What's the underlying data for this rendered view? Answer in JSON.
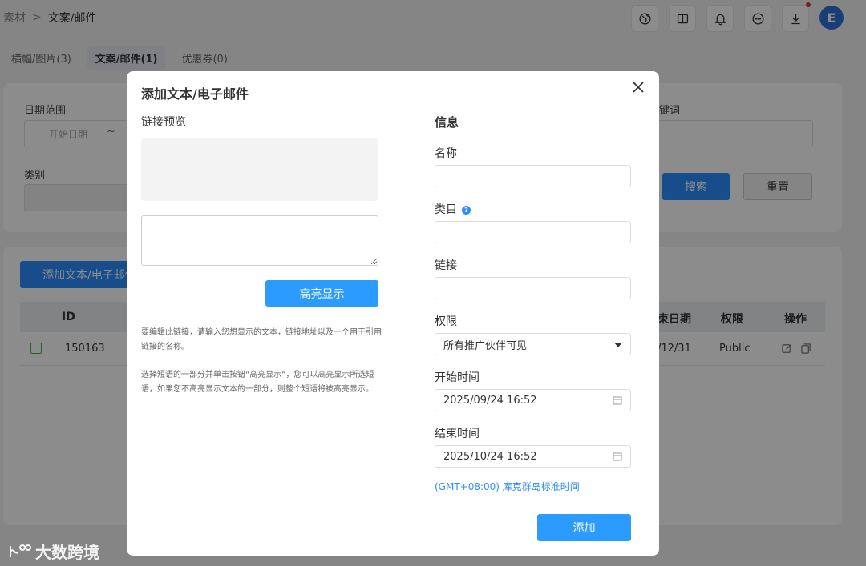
{
  "breadcrumb": {
    "root": "素材",
    "separator": ">",
    "current": "文案/邮件"
  },
  "topbar": {
    "avatar_letter": "E",
    "notification_dot": true
  },
  "tabs": [
    {
      "label": "横幅/图片(3)"
    },
    {
      "label": "文案/邮件(1)",
      "active": true
    },
    {
      "label": "优惠券(0)"
    }
  ],
  "filters": {
    "date_range_label": "日期范围",
    "start_placeholder": "开始日期",
    "range_sep": "~",
    "keyword_label": "键词",
    "category_label": "类别",
    "search_button": "搜索",
    "reset_button": "重置"
  },
  "list": {
    "add_button": "添加文本/电子邮件",
    "columns": {
      "id": "ID",
      "end_date": "束日期",
      "permission": "权限",
      "actions": "操作"
    },
    "rows": [
      {
        "id": "150163",
        "end_date": "/12/31",
        "permission": "Public"
      }
    ]
  },
  "watermark": {
    "text": "大数跨境"
  },
  "modal": {
    "title": "添加文本/电子邮件",
    "link_preview_label": "链接预览",
    "highlight_button": "高亮显示",
    "help_1": "要编辑此链接，请输入您想显示的文本，链接地址以及一个用于引用链接的名称。",
    "help_2": "选择短语的一部分并单击按钮“高亮显示”，您可以高亮显示所选短语，如果您不高亮显示文本的一部分，则整个短语将被高亮显示。",
    "info_heading": "信息",
    "name_label": "名称",
    "name_value": "",
    "category_label": "类目",
    "category_value": "",
    "link_label": "链接",
    "link_value": "",
    "permission_label": "权限",
    "permission_value": "所有推广伙伴可见",
    "start_time_label": "开始时间",
    "start_time_value": "2025/09/24 16:52",
    "end_time_label": "结束时间",
    "end_time_value": "2025/10/24 16:52",
    "timezone": "(GMT+08:00) 库克群岛标准时间",
    "submit_button": "添加"
  },
  "colors": {
    "primary": "#2c9bff",
    "overlay": "rgba(0,0,0,0.45)",
    "avatar": "#2f6fd6"
  }
}
